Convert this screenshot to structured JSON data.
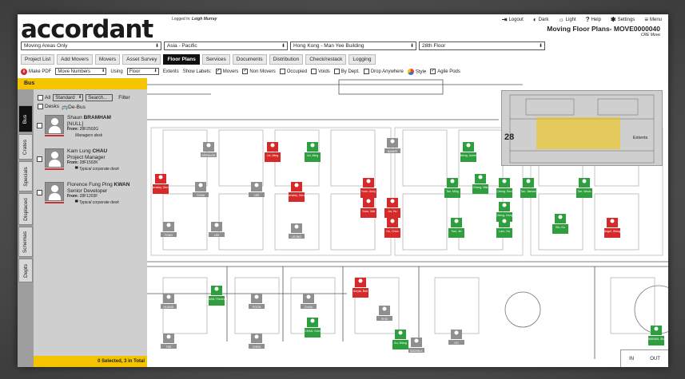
{
  "header": {
    "logo": "accordant",
    "logged_in_label": "Logged In:",
    "logged_in_user": "Leigh Murray",
    "nav": [
      {
        "icon": "logout-icon",
        "glyph": "⇥",
        "label": "Logout"
      },
      {
        "icon": "dark-icon",
        "glyph": "◐",
        "label": "Dark"
      },
      {
        "icon": "light-icon",
        "glyph": "☼",
        "label": "Light"
      },
      {
        "icon": "help-icon",
        "glyph": "?",
        "label": "Help"
      },
      {
        "icon": "settings-icon",
        "glyph": "✱",
        "label": "Settings"
      },
      {
        "icon": "menu-icon",
        "glyph": "≡",
        "label": "Menu"
      }
    ],
    "title": "Moving Floor Plans- MOVE0000040",
    "subtitle": "CRE Move"
  },
  "selects": {
    "areas": "Moving Areas Only",
    "region": "Asia - Pacific",
    "building": "Hong Kong - Man Yee Building",
    "floor": "28th Floor"
  },
  "tabs": [
    "Project List",
    "Add Movers",
    "Movers",
    "Asset Survey",
    "Floor Plans",
    "Services",
    "Documents",
    "Distribution",
    "Check/restack",
    "Logging"
  ],
  "active_tab": "Floor Plans",
  "toolbar": {
    "make_pdf": "Make PDF",
    "move_numbers": "Move Numbers",
    "using": "Using",
    "floor": "Floor",
    "extents": "Extents",
    "show_labels": "Show Labels:",
    "movers": "Movers",
    "non_movers": "Non Movers",
    "occupied": "Occupied",
    "voids": "Voids",
    "by_dept": "By Dept.",
    "drop_anywhere": "Drop Anywhere",
    "style": "Style",
    "agile_pods": "Agile Pods"
  },
  "left_panel": {
    "title": "Bus",
    "side_tabs": [
      "Bus",
      "Crates",
      "Specials",
      "Displaced",
      "Schemas",
      "Depts"
    ],
    "all_label": "All",
    "standard": "Standard",
    "search": "Search...",
    "filter": "Filter",
    "desks": "Desks",
    "de_bus": "De-Bus",
    "people": [
      {
        "name_first": "Shaun",
        "name_last": "BRAMHAM",
        "role": "[NULL]",
        "from_label": "From:",
        "from": "28F2502G",
        "desk": "Managers desk"
      },
      {
        "name_first": "Kam Lung",
        "name_last": "CHAU",
        "role": "Project Manager",
        "from_label": "From:",
        "from": "28F1502K",
        "desk": "Typical corporate desk"
      },
      {
        "name_first": "Florence Fung Ping",
        "name_last": "KWAN",
        "role": "Senior Developer",
        "from_label": "From:",
        "from": "28F1203F",
        "desk": "Typical corporate desk"
      }
    ],
    "footer": "0 Selected, 3 in Total"
  },
  "plan_labels": {
    "gray": [
      "ERENLER",
      "CHAN",
      "LEE",
      "FONG",
      "LEE",
      "LEUNG",
      "BAKER",
      "HUANG",
      "POON",
      "CHAN",
      "SHIU",
      "TSE",
      "CHEN",
      "BADMILK",
      "HO"
    ],
    "red": [
      "Lin, Ming",
      "Bensley, Gerry",
      "Bensley, Gerry",
      "Yuen, Anny",
      "Yuen, Wai",
      "Au, Hu",
      "Ho, Chun",
      "Amyla, Bob",
      "Angel, Wong"
    ],
    "green": [
      "Lin, Ming",
      "Meng, Aoren",
      "Tan, Ming",
      "Cheng, Ren",
      "Cheng, Hong",
      "Tan, Jianwei",
      "Chang, Wai",
      "Wu, Ko",
      "KWAN, Florence",
      "CHAU, Kam",
      "BRAMHAM, Shaun",
      "Tan, Woon",
      "Tsui, Jin",
      "Lam, Ho",
      "Au, Wang"
    ]
  },
  "minimap": {
    "floor_number": "28",
    "extents": "Extents"
  },
  "zoom": {
    "in": "IN",
    "out": "OUT"
  },
  "colors": {
    "accent": "#f5c400",
    "mover_red": "#d62a2a",
    "mover_green": "#2e9e3e",
    "existing_gray": "#8f8f8f"
  }
}
